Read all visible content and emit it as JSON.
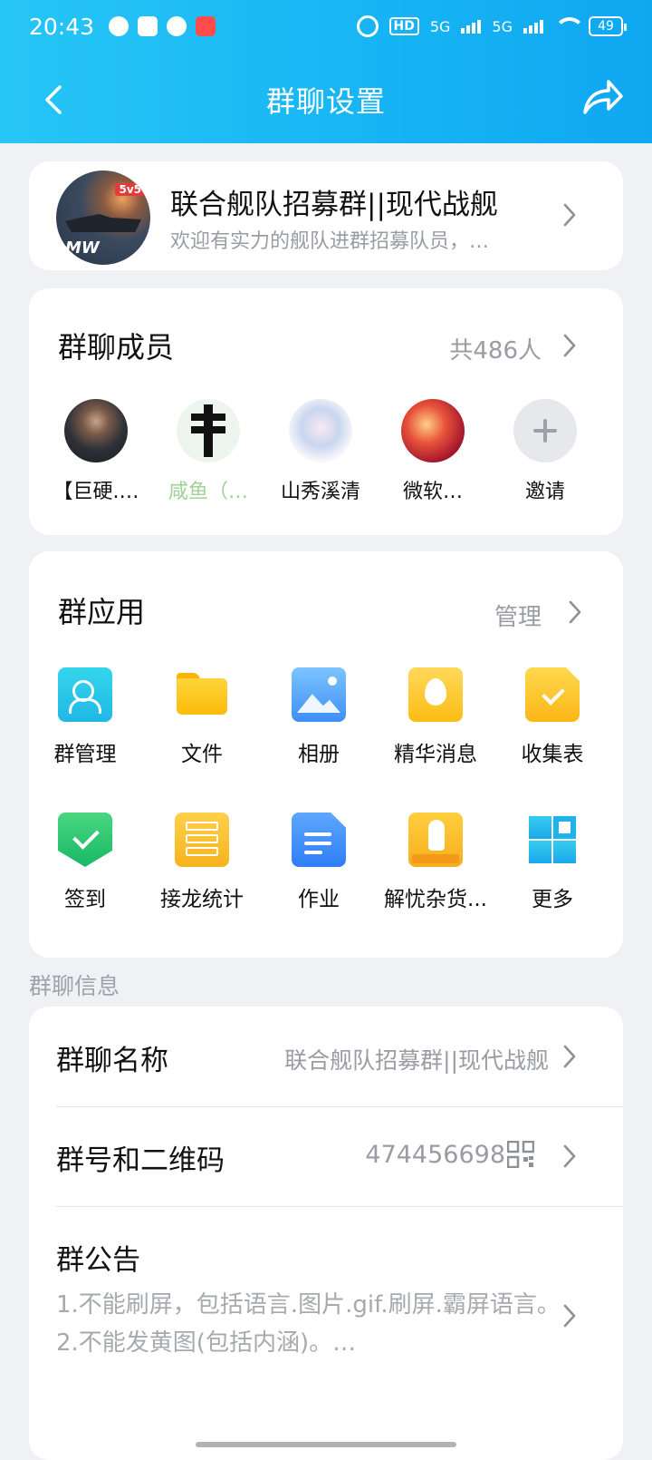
{
  "status_bar": {
    "time": "20:43",
    "hd": "HD",
    "net1": "5G",
    "net2": "5G",
    "battery": "49"
  },
  "header": {
    "title": "群聊设置"
  },
  "group": {
    "name": "联合舰队招募群||现代战舰",
    "description": "欢迎有实力的舰队进群招募队员，…",
    "avatar_badge": "5v5",
    "avatar_mark": "MW"
  },
  "members": {
    "title": "群聊成员",
    "count": "共486人",
    "list": [
      {
        "name": "【巨硬.…"
      },
      {
        "name": "咸鱼（…"
      },
      {
        "name": "山秀溪清"
      },
      {
        "name": "微软…"
      },
      {
        "name": "邀请"
      }
    ]
  },
  "apps": {
    "title": "群应用",
    "manage": "管理",
    "items": [
      {
        "label": "群管理",
        "icon": "group-manage-icon"
      },
      {
        "label": "文件",
        "icon": "folder-icon"
      },
      {
        "label": "相册",
        "icon": "album-icon"
      },
      {
        "label": "精华消息",
        "icon": "essence-icon"
      },
      {
        "label": "收集表",
        "icon": "form-icon"
      },
      {
        "label": "签到",
        "icon": "checkin-icon"
      },
      {
        "label": "接龙统计",
        "icon": "chain-stats-icon"
      },
      {
        "label": "作业",
        "icon": "homework-icon"
      },
      {
        "label": "解忧杂货...",
        "icon": "grocery-icon"
      },
      {
        "label": "更多",
        "icon": "more-grid-icon"
      }
    ]
  },
  "info": {
    "section_label": "群聊信息",
    "name_label": "群聊名称",
    "name_value": "联合舰队招募群||现代战舰",
    "number_label": "群号和二维码",
    "number_value": "474456698",
    "notice_label": "群公告",
    "notice_line1": "1.不能刷屏，包括语言.图片.gif.刷屏.霸屏语言。",
    "notice_line2": "2.不能发黄图(包括内涵)。…"
  },
  "colors": {
    "header_start": "#27c6f6",
    "header_end": "#10a7f1",
    "background": "#f0f1f5",
    "muted_text": "#9a9ca3"
  }
}
